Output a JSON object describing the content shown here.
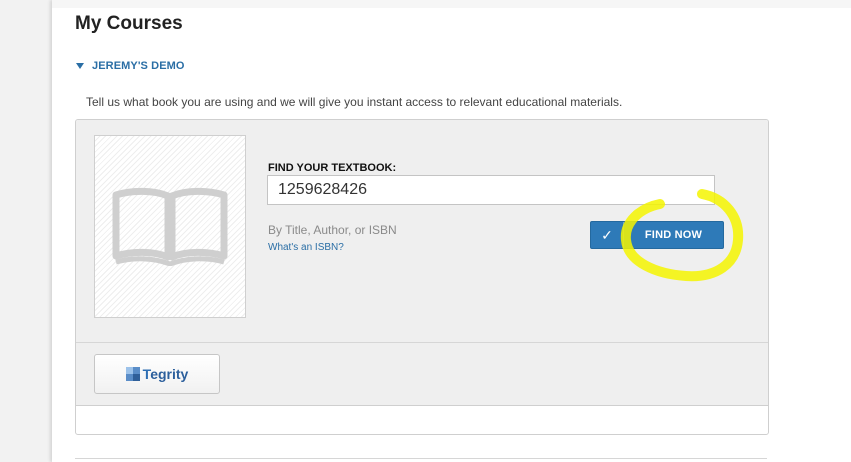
{
  "page": {
    "title": "My Courses"
  },
  "course": {
    "name": "JEREMY'S DEMO"
  },
  "intro": "Tell us what book you are using and we will give you instant access to relevant educational materials.",
  "finder": {
    "label": "FIND YOUR TEXTBOOK:",
    "value": "1259628426",
    "hint": "By Title, Author, or ISBN",
    "isbn_link": "What's an ISBN?",
    "button_check": "✓",
    "button_label": "FIND NOW"
  },
  "tools": {
    "tegrity_label": "egrity",
    "tegrity_initial": "T"
  },
  "colors": {
    "accent": "#2e7ab8",
    "link": "#2a6ea5",
    "highlight": "#f4f400"
  }
}
